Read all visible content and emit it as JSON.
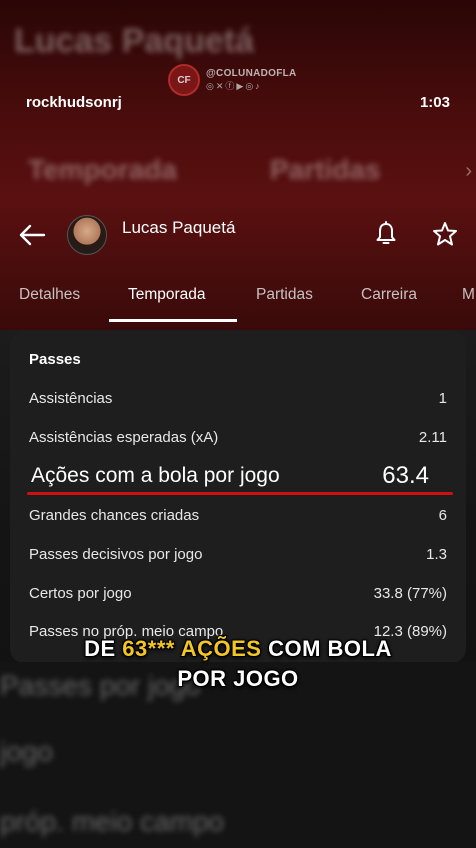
{
  "overlay": {
    "username": "rockhudsonrj",
    "timer": "1:03",
    "watermark_handle": "@COLUNADOFLA",
    "watermark_logo": "CF",
    "blurred_bg_title": "Lucas Paquetá",
    "blurred_bg_tab1": "Temporada",
    "blurred_bg_tab2": "Partidas",
    "blurred_bottom_1": "Passes por jogo",
    "blurred_bottom_2": "jogo",
    "blurred_bottom_3": "próp. meio campo"
  },
  "header": {
    "player_name": "Lucas Paquetá"
  },
  "tabs": [
    {
      "label": "Detalhes"
    },
    {
      "label": "Temporada"
    },
    {
      "label": "Partidas"
    },
    {
      "label": "Carreira"
    },
    {
      "label": "M"
    }
  ],
  "active_tab": "Temporada",
  "stats": {
    "section_title": "Passes",
    "rows": [
      {
        "label": "Assistências",
        "value": "1"
      },
      {
        "label": "Assistências esperadas (xA)",
        "value": "2.11"
      },
      {
        "label": "Ações com a bola por jogo",
        "value": "63.4"
      },
      {
        "label": "Grandes chances criadas",
        "value": "6"
      },
      {
        "label": "Passes decisivos por jogo",
        "value": "1.3"
      },
      {
        "label": "Certos por jogo",
        "value": "33.8 (77%)"
      },
      {
        "label": "Passes no próp. meio campo",
        "value": "12.3 (89%)"
      }
    ]
  },
  "caption": {
    "part1": "DE ",
    "highlight": "63*** AÇÕES",
    "part2": " COM BOLA",
    "line2": "POR JOGO"
  },
  "colors": {
    "accent_red": "#d01010",
    "caption_yellow": "#f4c623"
  }
}
